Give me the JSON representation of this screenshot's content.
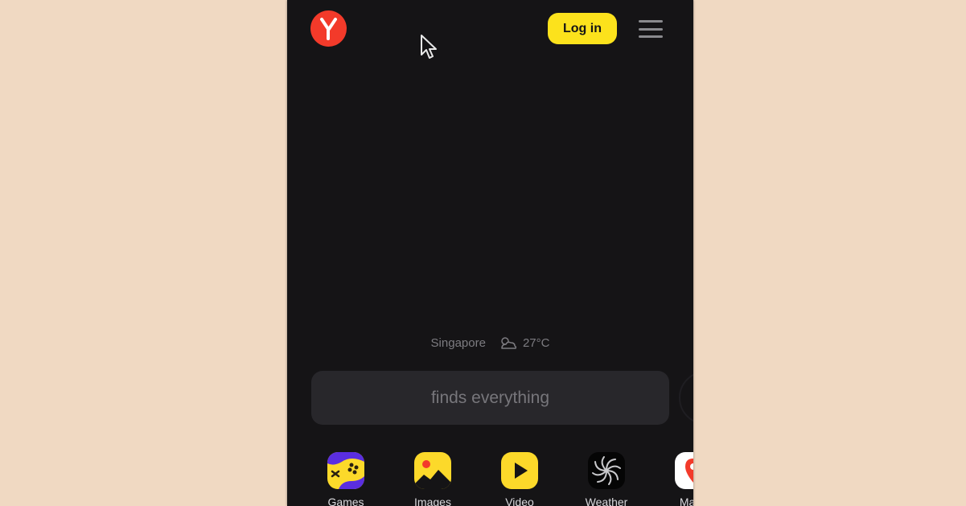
{
  "app": {
    "name": "Yandex",
    "logo_letter": "Y",
    "brand_color": "#f33a2a",
    "accent_color": "#fce21c"
  },
  "header": {
    "login_label": "Log in",
    "menu_icon": "hamburger-menu-icon"
  },
  "weather": {
    "city": "Singapore",
    "icon": "partly-cloudy-icon",
    "temperature": "27°C"
  },
  "search": {
    "placeholder": "finds everything"
  },
  "services": [
    {
      "label": "Games",
      "icon": "gamepad-icon"
    },
    {
      "label": "Images",
      "icon": "image-icon"
    },
    {
      "label": "Video",
      "icon": "play-icon"
    },
    {
      "label": "Weather",
      "icon": "swirl-icon"
    },
    {
      "label": "Maps",
      "icon": "map-pin-icon"
    }
  ]
}
